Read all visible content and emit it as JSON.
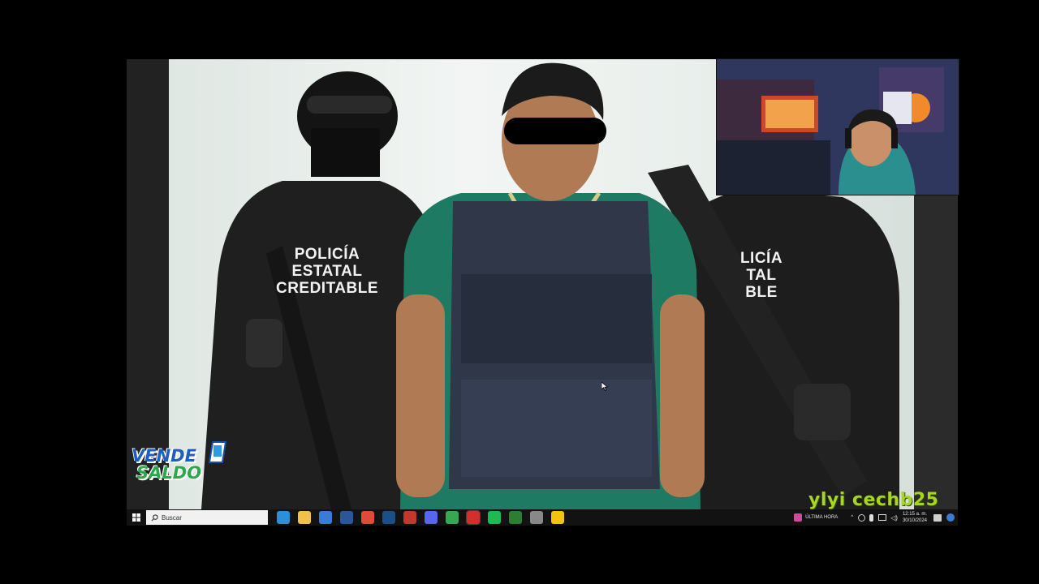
{
  "video": {
    "vest_left_lines": [
      "POLICÍA",
      "ESTATAL",
      "CREDITABLE"
    ],
    "vest_right_lines": [
      "LICÍA",
      "TAL",
      "BLE"
    ]
  },
  "overlay": {
    "logo_line1": "VENDE",
    "logo_line2": "SALDO",
    "watermark": "ylyi cechb25"
  },
  "taskbar": {
    "search_placeholder": "Buscar",
    "tray_label": "ÚLTIMA HORA",
    "clock_time": "12:15 a. m.",
    "clock_date": "30/10/2024",
    "pinned_apps": [
      "edge-icon",
      "file-explorer-icon",
      "store-icon",
      "word-icon",
      "chrome-alt-icon",
      "steam-icon",
      "app-icon",
      "discord-icon",
      "chrome-icon",
      "opera-icon",
      "spotify-icon",
      "xbox-icon",
      "app2-icon",
      "duck-icon"
    ],
    "pinned_colors": [
      "#2b8fd9",
      "#f2c14a",
      "#3a7bd5",
      "#2b579a",
      "#e04a3a",
      "#1b4f86",
      "#c0392b",
      "#5865f2",
      "#34a853",
      "#d62d2d",
      "#1db954",
      "#2e7d32",
      "#888888",
      "#f1c40f"
    ]
  }
}
